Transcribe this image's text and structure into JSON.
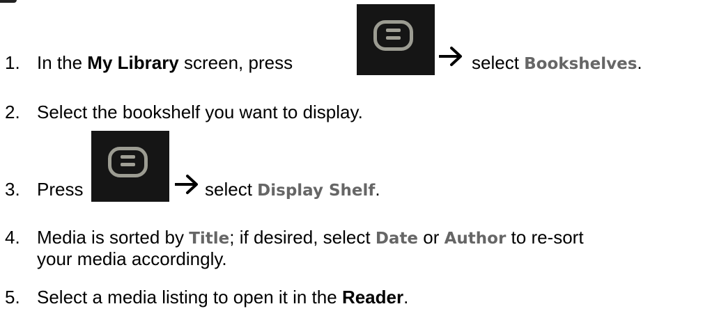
{
  "steps": [
    {
      "number": "1.",
      "pre": "In the ",
      "bold": "My Library",
      "mid": " screen, press ",
      "after": " select ",
      "keyword": "Bookshelves",
      "end": "."
    },
    {
      "number": "2.",
      "text": "Select the bookshelf you want to display."
    },
    {
      "number": "3.",
      "pre": "Press ",
      "after": " select ",
      "keyword": "Display Shelf",
      "end": "."
    },
    {
      "number": "4.",
      "pre": "Media is sorted by ",
      "kw1": "Title",
      "mid1": "; if desired, select ",
      "kw2": "Date",
      "mid2": " or ",
      "kw3": "Author",
      "mid3": " to re-sort",
      "line2": "your media accordingly."
    },
    {
      "number": "5.",
      "pre": "Select a media listing to open it in the ",
      "bold": "Reader",
      "end": "."
    }
  ],
  "icons": {
    "menu_button": "menu-button-icon",
    "arrow": "right-arrow-icon"
  },
  "colors": {
    "text": "#000000",
    "keyword": "#666666",
    "button_bg": "#151515",
    "button_outline": "#9c9c92"
  }
}
